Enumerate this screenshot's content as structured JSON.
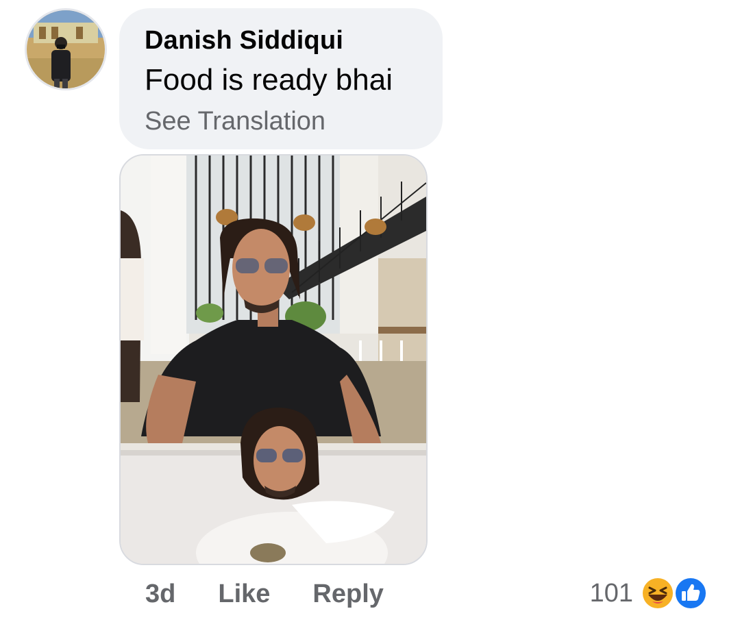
{
  "comment": {
    "author": "Danish Siddiqui",
    "text": "Food is ready bhai",
    "translate_label": "See Translation"
  },
  "actions": {
    "time": "3d",
    "like_label": "Like",
    "reply_label": "Reply"
  },
  "reactions": {
    "count": "101",
    "icons": [
      "haha-reaction-icon",
      "like-reaction-icon"
    ]
  },
  "colors": {
    "bubble": "#f0f2f5",
    "primary_text": "#050505",
    "secondary_text": "#65676b",
    "like_blue": "#1877f2",
    "haha_yellow": "#f7b125"
  }
}
